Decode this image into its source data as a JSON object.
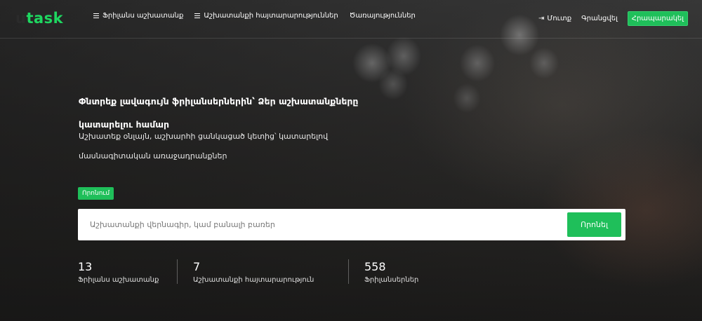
{
  "logo": {
    "prefix": "u",
    "text": "task"
  },
  "nav": {
    "left": [
      {
        "label": "Ֆրիլանս աշխատանք",
        "icon": "list-icon"
      },
      {
        "label": "Աշխատանքի հայտարարություններ",
        "icon": "list-icon"
      },
      {
        "label": "Ծառայություններ"
      }
    ],
    "login": "Մուտք",
    "register": "Գրանցվել",
    "publish": "Հրապարակել"
  },
  "hero": {
    "title": "Փնտրեք լավագույն ֆրիլանսերներին՝ Ձեր աշխատանքները կատարելու համար",
    "subtitle": "Աշխատեք օնլայն, աշխարհի ցանկացած կետից՝ կատարելով մասնագիտական առաջադրանքներ"
  },
  "search": {
    "tag": "Որոնում",
    "placeholder": "Աշխատանքի վերնագիր, կամ բանալի բառեր",
    "button": "Որոնել"
  },
  "stats": [
    {
      "value": "13",
      "label": "Ֆրիլանս աշխատանք"
    },
    {
      "value": "7",
      "label": "Աշխատանքի հայտարարություն"
    },
    {
      "value": "558",
      "label": "Ֆրիլանսերներ"
    }
  ],
  "colors": {
    "accent": "#1fbf5a",
    "logo": "#1ed760"
  }
}
